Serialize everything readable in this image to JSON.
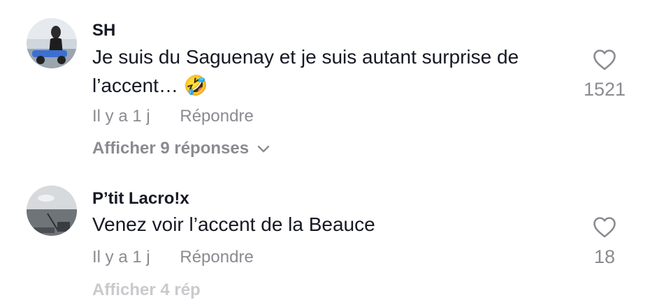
{
  "comments": [
    {
      "username": "SH",
      "text_line1": "Je suis du Saguenay et je suis autant surprise de",
      "text_line2": "l’accent… 🤣",
      "time": "Il y a 1 j",
      "reply_label": "Répondre",
      "replies_label": "Afficher 9 réponses",
      "likes": "1521",
      "like_icon": "heart-outline-icon"
    },
    {
      "username": "P’tit Lacro!x",
      "text_line1": "Venez voir l’accent de la Beauce",
      "time": "Il y a 1 j",
      "reply_label": "Répondre",
      "likes": "18",
      "like_icon": "heart-outline-icon"
    }
  ],
  "partial_replies_label": "Afficher 4 rép",
  "colors": {
    "text_primary": "#161823",
    "text_secondary": "#8a8b91"
  }
}
